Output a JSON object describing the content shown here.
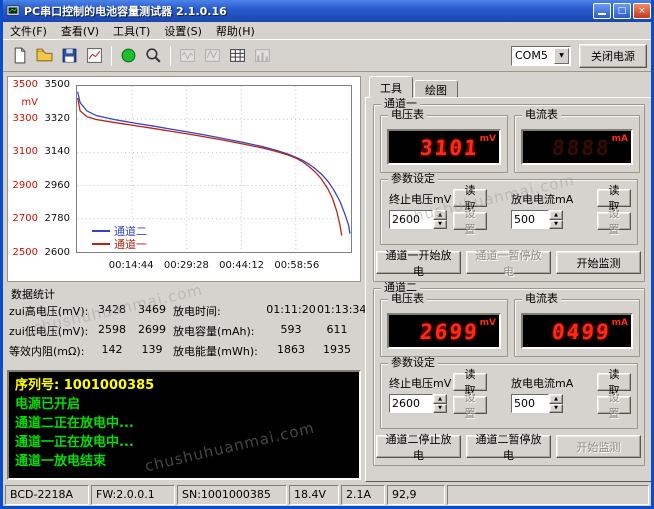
{
  "window": {
    "title": "PC串口控制的电池容量测试器  2.1.0.16"
  },
  "glyphs": {
    "maximize": "□",
    "close": "×",
    "down": "▼",
    "up": "▲"
  },
  "menu": {
    "items": [
      {
        "label": "文件(F)"
      },
      {
        "label": "查看(V)"
      },
      {
        "label": "工具(T)"
      },
      {
        "label": "设置(S)"
      },
      {
        "label": "帮助(H)"
      }
    ]
  },
  "toolbar": {
    "com_port": "COM5",
    "power_button_label": "关闭电源"
  },
  "tabs": [
    {
      "label": "工具"
    },
    {
      "label": "绘图"
    }
  ],
  "chart_data": {
    "type": "line",
    "y_unit": "mV",
    "y_axis_channel1": [
      "3500",
      "3300",
      "3100",
      "2900",
      "2700",
      "2500"
    ],
    "y_axis_channel2": [
      "3500",
      "3320",
      "3140",
      "2960",
      "2780",
      "2600"
    ],
    "x_ticks": [
      "00:14:44",
      "00:29:28",
      "00:44:12",
      "00:58:56"
    ],
    "x_max_seconds": 4420,
    "grid": true,
    "legend_position": "bottom-left",
    "series": [
      {
        "name": "通道二",
        "color": "#3344cc",
        "ylim": [
          2600,
          3500
        ],
        "points": [
          [
            0,
            3469
          ],
          [
            40,
            3410
          ],
          [
            150,
            3365
          ],
          [
            300,
            3340
          ],
          [
            600,
            3318
          ],
          [
            900,
            3300
          ],
          [
            1200,
            3284
          ],
          [
            1500,
            3267
          ],
          [
            1800,
            3250
          ],
          [
            2100,
            3232
          ],
          [
            2400,
            3213
          ],
          [
            2700,
            3193
          ],
          [
            3000,
            3171
          ],
          [
            3200,
            3153
          ],
          [
            3400,
            3132
          ],
          [
            3536,
            3114
          ],
          [
            3650,
            3096
          ],
          [
            3750,
            3076
          ],
          [
            3850,
            3052
          ],
          [
            3950,
            3022
          ],
          [
            4050,
            2986
          ],
          [
            4150,
            2938
          ],
          [
            4250,
            2876
          ],
          [
            4330,
            2806
          ],
          [
            4390,
            2748
          ],
          [
            4414,
            2699
          ]
        ]
      },
      {
        "name": "通道一",
        "color": "#bb2211",
        "ylim": [
          2500,
          3500
        ],
        "points": [
          [
            0,
            3428
          ],
          [
            40,
            3350
          ],
          [
            150,
            3315
          ],
          [
            300,
            3298
          ],
          [
            600,
            3280
          ],
          [
            900,
            3263
          ],
          [
            1200,
            3246
          ],
          [
            1500,
            3228
          ],
          [
            1800,
            3210
          ],
          [
            2100,
            3191
          ],
          [
            2400,
            3171
          ],
          [
            2700,
            3149
          ],
          [
            3000,
            3126
          ],
          [
            3200,
            3108
          ],
          [
            3400,
            3086
          ],
          [
            3536,
            3066
          ],
          [
            3650,
            3042
          ],
          [
            3750,
            3014
          ],
          [
            3850,
            2982
          ],
          [
            3950,
            2940
          ],
          [
            4050,
            2884
          ],
          [
            4130,
            2824
          ],
          [
            4200,
            2744
          ],
          [
            4250,
            2664
          ],
          [
            4280,
            2598
          ]
        ]
      }
    ]
  },
  "stats": {
    "caption": "数据统计",
    "rows": [
      {
        "l1": "zui高电压(mV):",
        "v1": "3428",
        "v2": "3469",
        "l2": "放电时间:",
        "v3": "01:11:20",
        "v4": "01:13:34"
      },
      {
        "l1": "zui低电压(mV):",
        "v1": "2598",
        "v2": "2699",
        "l2": "放电容量(mAh):",
        "v3": "593",
        "v4": "611"
      },
      {
        "l1": "等效内阻(mΩ):",
        "v1": "142",
        "v2": "139",
        "l2": "放电能量(mWh):",
        "v3": "1863",
        "v4": "1935"
      }
    ]
  },
  "console": {
    "lines": [
      {
        "text": "序列号: 1001000385",
        "color": "#ffff00"
      },
      {
        "text": "电源已开启",
        "color": "#00e000"
      },
      {
        "text": "通道二正在放电中...",
        "color": "#00e000"
      },
      {
        "text": "通道一正在放电中...",
        "color": "#00e000"
      },
      {
        "text": "通道一放电结束",
        "color": "#00e000"
      }
    ]
  },
  "led": {
    "ghost": "8888"
  },
  "channels": [
    {
      "caption": "通道一",
      "voltmeter": {
        "caption": "电压表",
        "value": "3101",
        "unit": "mV"
      },
      "ammeter": {
        "caption": "电流表",
        "value": "",
        "unit": "mA"
      },
      "params": {
        "caption": "参数设定",
        "voltage_label": "终止电压mV",
        "voltage_value": "2600",
        "current_label": "放电电流mA",
        "current_value": "500",
        "read_label": "读取",
        "set_label": "设置",
        "read_enabled": true,
        "set_enabled": false
      },
      "buttons": [
        {
          "label": "通道一开始放电",
          "enabled": true
        },
        {
          "label": "通道一暂停放电",
          "enabled": false
        },
        {
          "label": "开始监测",
          "enabled": true
        }
      ]
    },
    {
      "caption": "通道二",
      "voltmeter": {
        "caption": "电压表",
        "value": "2699",
        "unit": "mV"
      },
      "ammeter": {
        "caption": "电流表",
        "value": "0499",
        "unit": "mA"
      },
      "params": {
        "caption": "参数设定",
        "voltage_label": "终止电压mV",
        "voltage_value": "2600",
        "current_label": "放电电流mA",
        "current_value": "500",
        "read_label": "读取",
        "set_label": "设置",
        "read_enabled": true,
        "set_enabled": false
      },
      "buttons": [
        {
          "label": "通道二停止放电",
          "enabled": true
        },
        {
          "label": "通道二暂停放电",
          "enabled": true
        },
        {
          "label": "开始监测",
          "enabled": false
        }
      ]
    }
  ],
  "statusbar": {
    "panels": [
      {
        "text": "BCD-2218A"
      },
      {
        "text": "FW:2.0.0.1"
      },
      {
        "text": "SN:1001000385"
      },
      {
        "text": "18.4V"
      },
      {
        "text": "2.1A"
      },
      {
        "text": "92,9"
      },
      {
        "text": ""
      }
    ]
  },
  "watermark": {
    "text": "chushuhuanmai.com"
  }
}
